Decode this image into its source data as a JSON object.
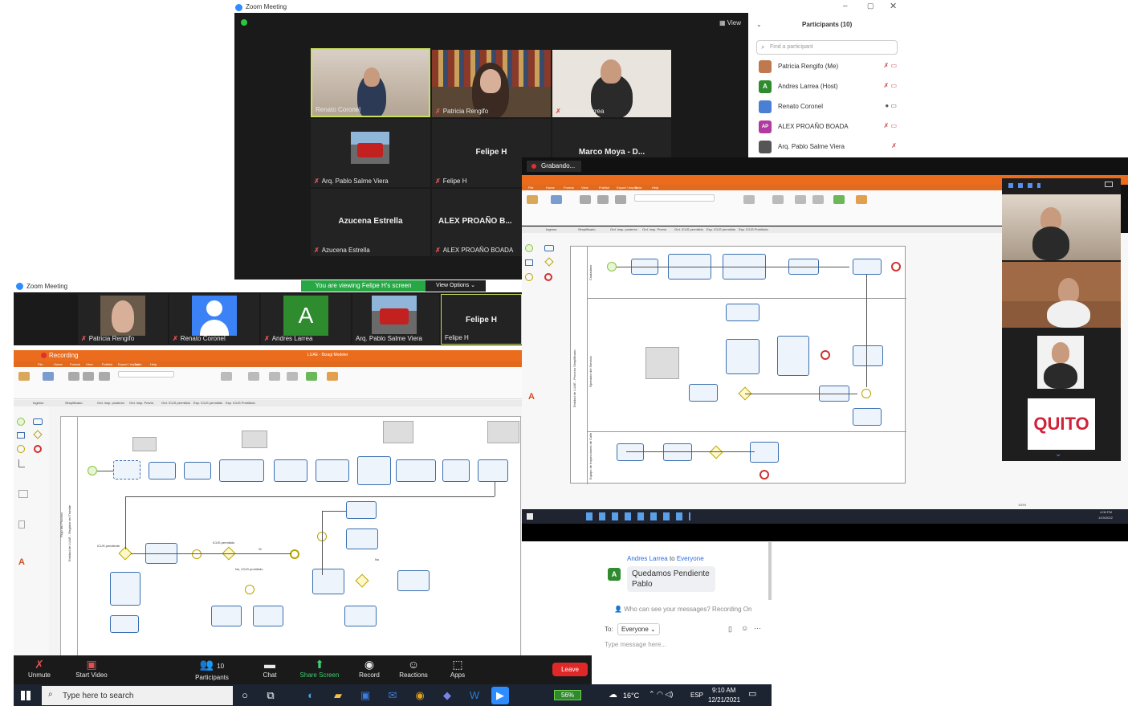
{
  "back_window": {
    "title": "Zoom Meeting",
    "view_label": "View",
    "tiles": [
      {
        "name": "Renato Coronel",
        "muted": false
      },
      {
        "name": "Patricia Rengifo",
        "muted": true
      },
      {
        "name": "Andres Larrea",
        "muted": true
      },
      {
        "name": "Arq. Pablo Salme Viera",
        "muted": true
      },
      {
        "name": "Felipe H",
        "muted": true,
        "big": "Felipe H"
      },
      {
        "name": "",
        "muted": false,
        "big": "Marco Moya - D..."
      },
      {
        "name": "Azucena Estrella",
        "muted": true,
        "big": "Azucena Estrella"
      },
      {
        "name": "ALEX PROAÑO BOADA",
        "muted": true,
        "big": "ALEX PROAÑO B..."
      }
    ]
  },
  "participants_panel": {
    "title": "Participants (10)",
    "search_placeholder": "Find a participant",
    "items": [
      {
        "name": "Patricia Rengifo (Me)",
        "avatar": "",
        "color": "#c07850"
      },
      {
        "name": "Andres Larrea (Host)",
        "avatar": "A",
        "color": "#2e8b2e"
      },
      {
        "name": "Renato Coronel",
        "avatar": "",
        "color": "#4a7fd4"
      },
      {
        "name": "ALEX PROAÑO BOADA",
        "avatar": "AP",
        "color": "#b03aa0"
      },
      {
        "name": "Arq. Pablo Salme Viera",
        "avatar": "",
        "color": "#555555"
      }
    ]
  },
  "main_window": {
    "title": "Zoom Meeting",
    "banner": "You are viewing Felipe H's screen",
    "view_options": "View Options",
    "strip": [
      {
        "name": "Patricia Rengifo",
        "muted": true
      },
      {
        "name": "Renato Coronel",
        "muted": true
      },
      {
        "name": "Andres Larrea",
        "muted": true,
        "avatar": "A"
      },
      {
        "name": "Arq. Pablo Salme Viera",
        "muted": false
      },
      {
        "name": "Felipe H",
        "muted": false,
        "big": "Felipe H"
      }
    ],
    "app_title": "LUAE - Bizagi Modeler",
    "recording": "Recording",
    "tabs": [
      "File",
      "Home",
      "Format",
      "View",
      "Publish",
      "Export / Import",
      "Tools",
      "Help"
    ],
    "sheet_tabs": [
      "Ingreso",
      "Simplificado",
      "Ord. insp. posterior",
      "Ord. insp. Previa",
      "Ord. ICUS permitido",
      "Esp. ICUS permitido",
      "Esp. ICUS Prohibido"
    ],
    "pool_label": "Flujo del Proceso",
    "lane_label": "Entidad de LUAE - Registro del Trámite",
    "labels": {
      "icus_pending": "ICUS pendiente",
      "icus_permitido": "ICUS permitido",
      "no_icus": "No, ICUS prohibido",
      "si": "Si",
      "no": "No"
    }
  },
  "controls": {
    "unmute": "Unmute",
    "start_video": "Start Video",
    "participants": "Participants",
    "participants_count": "10",
    "chat": "Chat",
    "share_screen": "Share Screen",
    "record": "Record",
    "reactions": "Reactions",
    "apps": "Apps",
    "leave": "Leave"
  },
  "chat": {
    "sender": "Andres Larrea",
    "to_word": "to",
    "recipient": "Everyone",
    "avatar": "A",
    "message": "Quedamos Pendiente Pablo",
    "privacy": "Who can see your messages? Recording On",
    "to_label": "To:",
    "to_value": "Everyone",
    "input_placeholder": "Type message here..."
  },
  "front_window": {
    "recording": "Grabando...",
    "tabs": [
      "File",
      "Home",
      "Format",
      "View",
      "Publish",
      "Export / Import",
      "Tools",
      "Help"
    ],
    "sheet_tabs": [
      "Ingreso",
      "Simplificado",
      "Ord. insp. posterior",
      "Ord. insp. Previa",
      "Ord. ICUS permitido",
      "Esp. ICUS permitido",
      "Esp. ICUS Prohibido"
    ],
    "pool_label": "Entidad de LUAE - Proceso Simplificado",
    "lanes": [
      "Ciudadano",
      "Operador del Servicio",
      "Equipo de Inspecciones de Calle"
    ],
    "quito": "QUITO",
    "clock": "4:08 PM",
    "date": "1/19/2022",
    "zoom": "100%"
  },
  "taskbar": {
    "search_placeholder": "Type here to search",
    "battery": "56%",
    "temperature": "16°C",
    "lang": "ESP",
    "time": "9:10 AM",
    "date": "12/21/2021"
  }
}
